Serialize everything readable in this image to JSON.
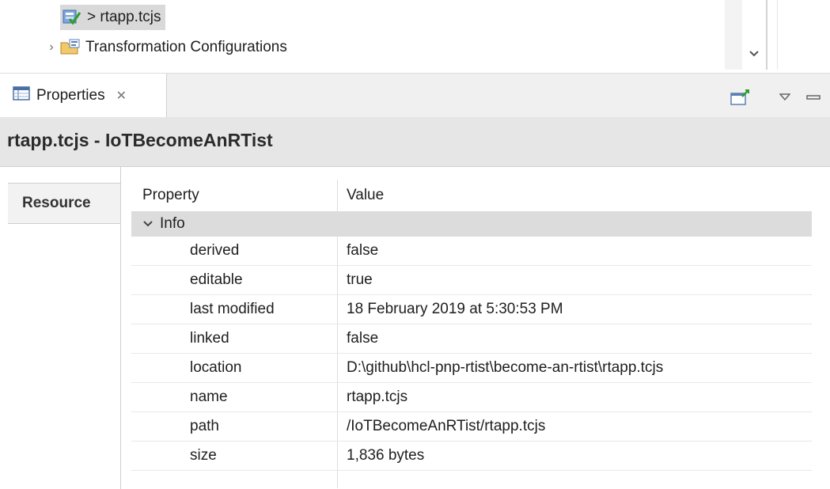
{
  "tree": {
    "items": [
      {
        "label": "> rtapp.tcjs",
        "icon": "tcjs-check-icon",
        "selected": true
      },
      {
        "label": "Transformation Configurations",
        "icon": "transformation-config-folder-icon",
        "selected": false
      }
    ]
  },
  "view": {
    "tab_label": "Properties",
    "close_glyph": "✕"
  },
  "title": "rtapp.tcjs - IoTBecomeAnRTist",
  "left_tab": "Resource",
  "table": {
    "headers": {
      "property": "Property",
      "value": "Value"
    },
    "category": "Info",
    "rows": [
      {
        "property": "derived",
        "value": "false"
      },
      {
        "property": "editable",
        "value": "true"
      },
      {
        "property": "last modified",
        "value": "18 February 2019 at 5:30:53 PM"
      },
      {
        "property": "linked",
        "value": "false"
      },
      {
        "property": "location",
        "value": "D:\\github\\hcl-pnp-rtist\\become-an-rtist\\rtapp.tcjs"
      },
      {
        "property": "name",
        "value": "rtapp.tcjs"
      },
      {
        "property": "path",
        "value": "/IoTBecomeAnRTist/rtapp.tcjs"
      },
      {
        "property": "size",
        "value": "1,836  bytes"
      }
    ]
  },
  "colors": {
    "selection": "#d9d9d9",
    "category_bg": "#dcdcdc",
    "title_bg": "#e6e6e6"
  }
}
